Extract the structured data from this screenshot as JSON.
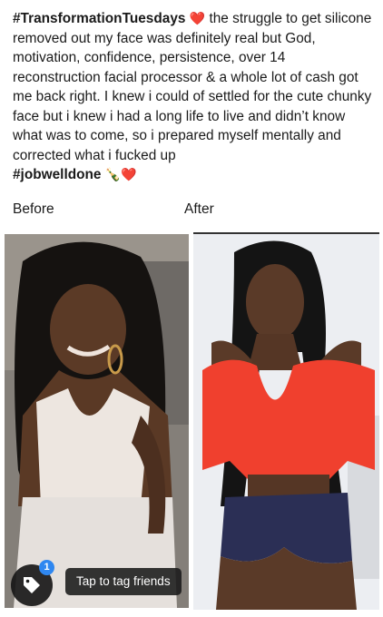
{
  "post": {
    "hashtag_start": "#TransformationTuesdays",
    "heart_emoji": "❤️",
    "body": " the struggle to get silicone removed out my face was definitely real but God, motivation, confidence, persistence, over 14 reconstruction facial processor & a whole lot of cash got me back right. I knew i could of settled for the cute chunky face but i knew i had a long life to live and didn’t know what was to come, so i prepared myself mentally and corrected what i fucked up",
    "hashtag_end": "#jobwelldone",
    "end_emojis": "🍾❤️"
  },
  "labels": {
    "before": "Before",
    "after": "After"
  },
  "photos": {
    "before_alt": "Before photo",
    "after_alt": "After photo"
  },
  "tagging": {
    "badge_count": "1",
    "prompt": "Tap to tag friends"
  },
  "colors": {
    "heart": "#e0102a",
    "badge": "#2f87f0"
  }
}
